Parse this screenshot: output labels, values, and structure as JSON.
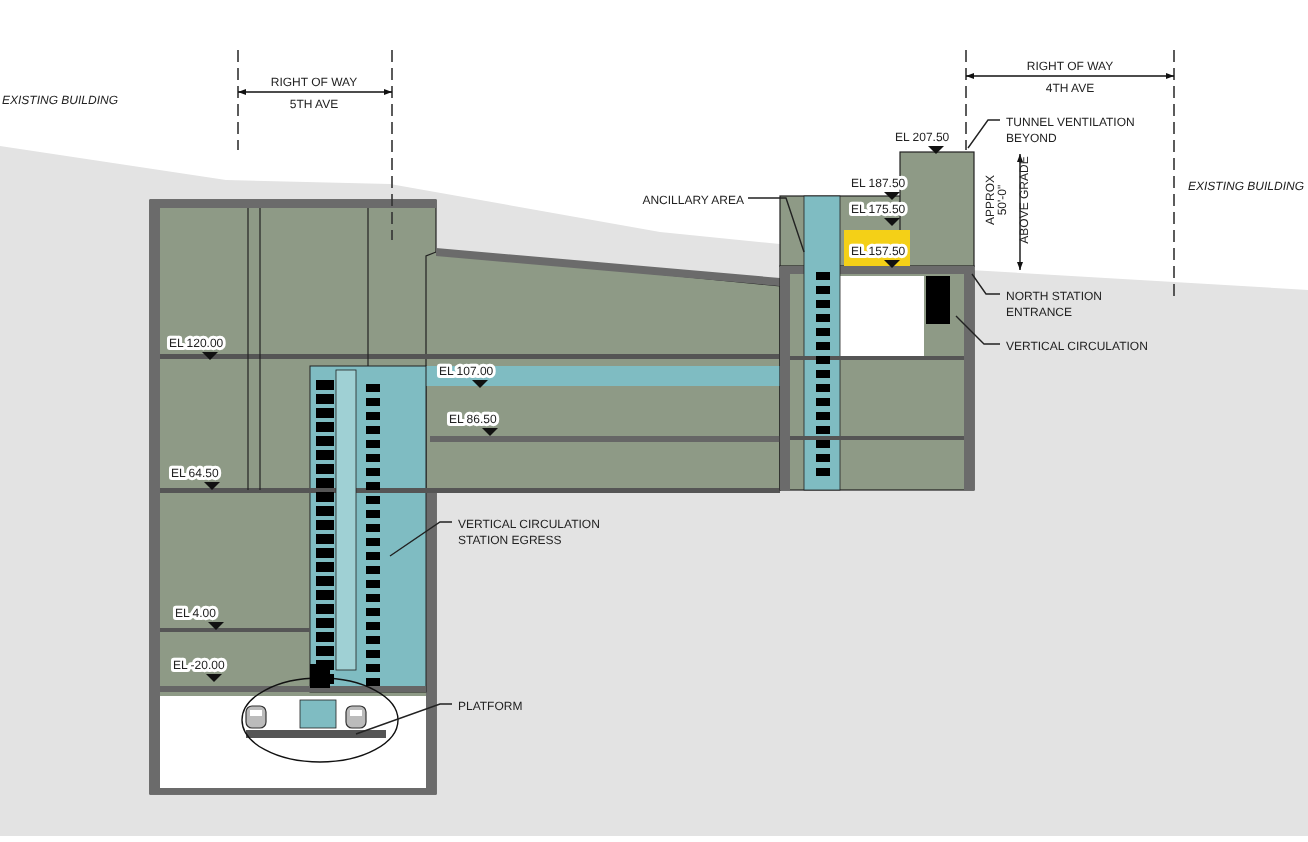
{
  "right_of_way": [
    {
      "title": "RIGHT OF WAY",
      "street": "5TH AVE"
    },
    {
      "title": "RIGHT OF WAY",
      "street": "4TH AVE"
    }
  ],
  "existing_buildings": [
    "EXISTING BUILDING",
    "EXISTING BUILDING"
  ],
  "elevations": [
    "EL 120.00",
    "EL 107.00",
    "EL 86.50",
    "EL 64.50",
    "EL 4.00",
    "EL -20.00",
    "EL 207.50",
    "EL 187.50",
    "EL 175.50",
    "EL 157.50"
  ],
  "callouts": [
    {
      "lines": [
        "ANCILLARY AREA"
      ]
    },
    {
      "lines": [
        "TUNNEL VENTILATION",
        "BEYOND"
      ]
    },
    {
      "lines": [
        "NORTH STATION",
        "ENTRANCE"
      ]
    },
    {
      "lines": [
        "VERTICAL CIRCULATION"
      ]
    },
    {
      "lines": [
        "VERTICAL CIRCULATION",
        "STATION EGRESS"
      ]
    },
    {
      "lines": [
        "PLATFORM"
      ]
    }
  ],
  "dimension": {
    "lines": [
      "APPROX",
      "50'-0\"",
      "ABOVE GRADE"
    ]
  }
}
